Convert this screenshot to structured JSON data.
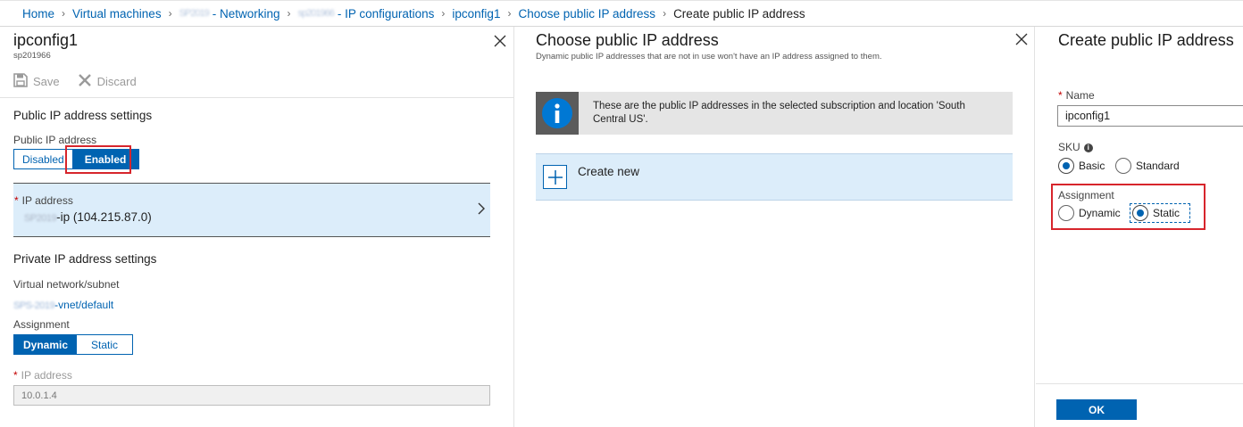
{
  "breadcrumb": {
    "items": [
      {
        "label": "Home"
      },
      {
        "label": "Virtual machines"
      },
      {
        "label": "SP2019",
        "blurred": true
      },
      {
        "label": "- Networking"
      },
      {
        "label": "sp201966",
        "blurred": true
      },
      {
        "label": "- IP configurations"
      },
      {
        "label": "ipconfig1"
      },
      {
        "label": "Choose public IP address"
      },
      {
        "label": "Create public IP address"
      }
    ]
  },
  "panel1": {
    "title": "ipconfig1",
    "subtitle": "sp201966",
    "toolbar": {
      "save_label": "Save",
      "discard_label": "Discard"
    },
    "public_section_title": "Public IP address settings",
    "public_ip_label": "Public IP address",
    "public_ip_toggle": {
      "options": [
        "Disabled",
        "Enabled"
      ],
      "selected": "Enabled"
    },
    "ip_address_label": "IP address",
    "ip_address_prefix": "SP2019",
    "ip_address_value": "-ip (104.215.87.0)",
    "private_section_title": "Private IP address settings",
    "vnet_label": "Virtual network/subnet",
    "vnet_prefix": "SPS-2019",
    "vnet_value": "-vnet/default",
    "assignment_label": "Assignment",
    "assignment_toggle": {
      "options": [
        "Dynamic",
        "Static"
      ],
      "selected": "Dynamic"
    },
    "private_ip_label": "IP address",
    "private_ip_value": "10.0.1.4"
  },
  "panel2": {
    "title": "Choose public IP address",
    "subtitle": "Dynamic public IP addresses that are not in use won't have an IP address assigned to them.",
    "info_message": "These are the public IP addresses in the selected subscription and location 'South Central US'.",
    "create_new_label": "Create new"
  },
  "panel3": {
    "title": "Create public IP address",
    "name_label": "Name",
    "name_value": "ipconfig1",
    "sku_label": "SKU",
    "sku_options": [
      "Basic",
      "Standard"
    ],
    "sku_selected": "Basic",
    "assignment_label": "Assignment",
    "assignment_options": [
      "Dynamic",
      "Static"
    ],
    "assignment_selected": "Static",
    "ok_label": "OK"
  },
  "colors": {
    "accent": "#0063b1",
    "highlight_border": "#d7252c",
    "selected_row_bg": "#dcedfa",
    "info_bg": "#e5e5e5"
  }
}
